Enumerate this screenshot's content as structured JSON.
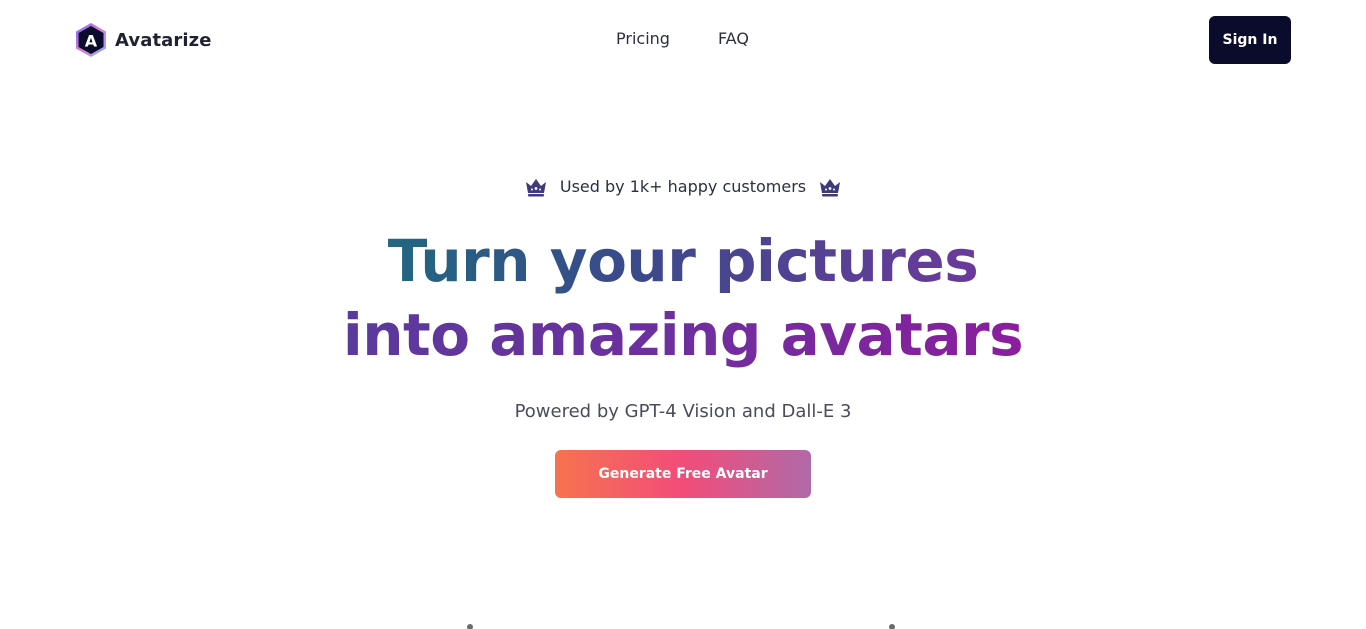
{
  "header": {
    "brand": {
      "name": "Avatarize",
      "logo_letter": "A",
      "logo_icon": "hexagon-logo-icon"
    },
    "nav": [
      {
        "label": "Pricing"
      },
      {
        "label": "FAQ"
      }
    ],
    "signin_label": "Sign In"
  },
  "hero": {
    "badge": {
      "text": "Used by 1k+ happy customers",
      "icon": "crown-icon"
    },
    "headline": {
      "line1": "Turn your pictures",
      "line2": "into amazing avatars"
    },
    "subtitle": "Powered by GPT-4 Vision and Dall-E 3",
    "cta_label": "Generate Free Avatar"
  },
  "colors": {
    "signin_bg": "#0b0b2b",
    "crown": "#3f3a78",
    "headline_start": "#21677f",
    "headline_end": "#8a1e9e",
    "cta_start": "#f6734f",
    "cta_mid": "#f24c79",
    "cta_end": "#b06aa8"
  }
}
